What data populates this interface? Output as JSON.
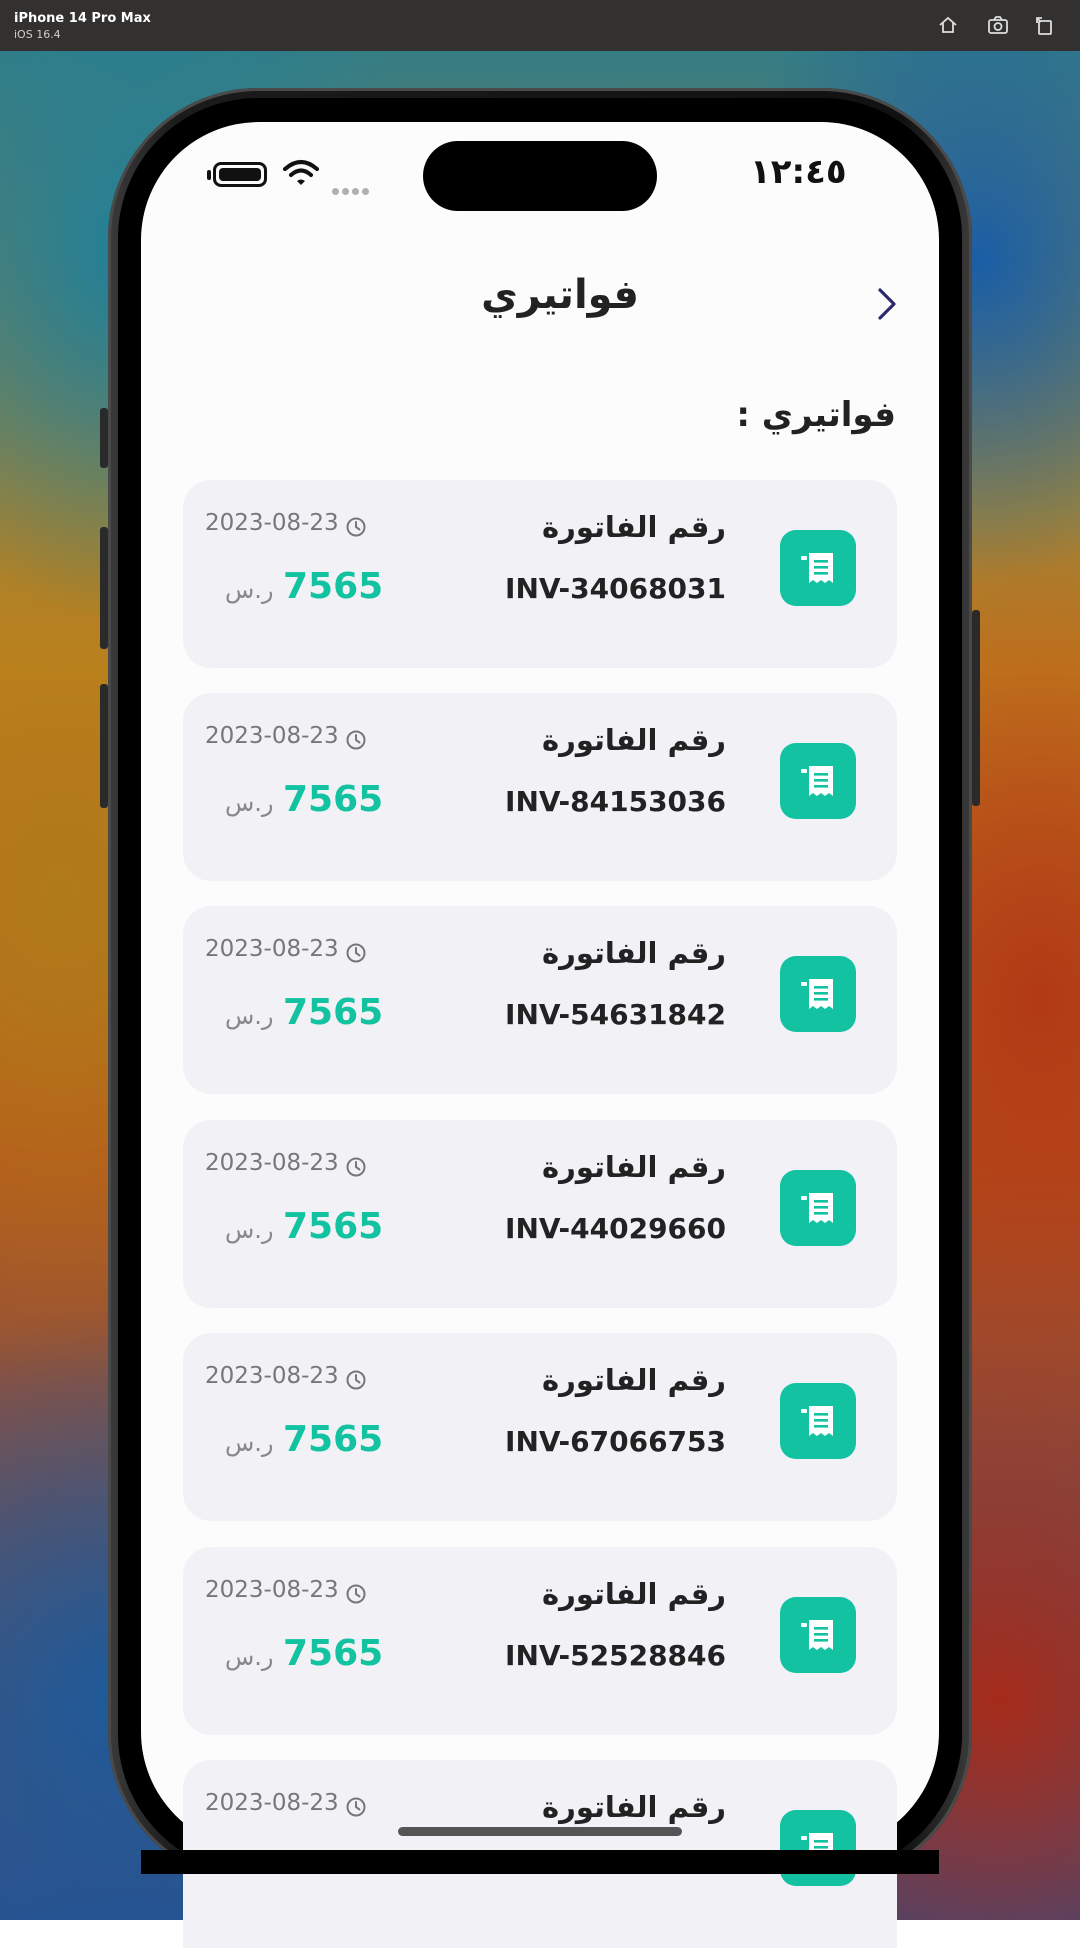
{
  "simulator": {
    "device": "iPhone 14 Pro Max",
    "os": "iOS 16.4"
  },
  "status_bar": {
    "time": "١٢:٤٥"
  },
  "header": {
    "title": "فواتيري"
  },
  "section": {
    "title": "فواتيري :"
  },
  "invoices": [
    {
      "label": "رقم الفاتورة",
      "number": "INV-34068031",
      "date": "2023-08-23",
      "amount": "7565",
      "currency": "ر.س"
    },
    {
      "label": "رقم الفاتورة",
      "number": "INV-84153036",
      "date": "2023-08-23",
      "amount": "7565",
      "currency": "ر.س"
    },
    {
      "label": "رقم الفاتورة",
      "number": "INV-54631842",
      "date": "2023-08-23",
      "amount": "7565",
      "currency": "ر.س"
    },
    {
      "label": "رقم الفاتورة",
      "number": "INV-44029660",
      "date": "2023-08-23",
      "amount": "7565",
      "currency": "ر.س"
    },
    {
      "label": "رقم الفاتورة",
      "number": "INV-67066753",
      "date": "2023-08-23",
      "amount": "7565",
      "currency": "ر.س"
    },
    {
      "label": "رقم الفاتورة",
      "number": "INV-52528846",
      "date": "2023-08-23",
      "amount": "7565",
      "currency": "ر.س"
    },
    {
      "label": "رقم الفاتورة",
      "date": "2023-08-23"
    }
  ],
  "colors": {
    "accent": "#12c2a1",
    "card_bg": "#f2f2f6",
    "back_arrow": "#2b2a6e"
  }
}
